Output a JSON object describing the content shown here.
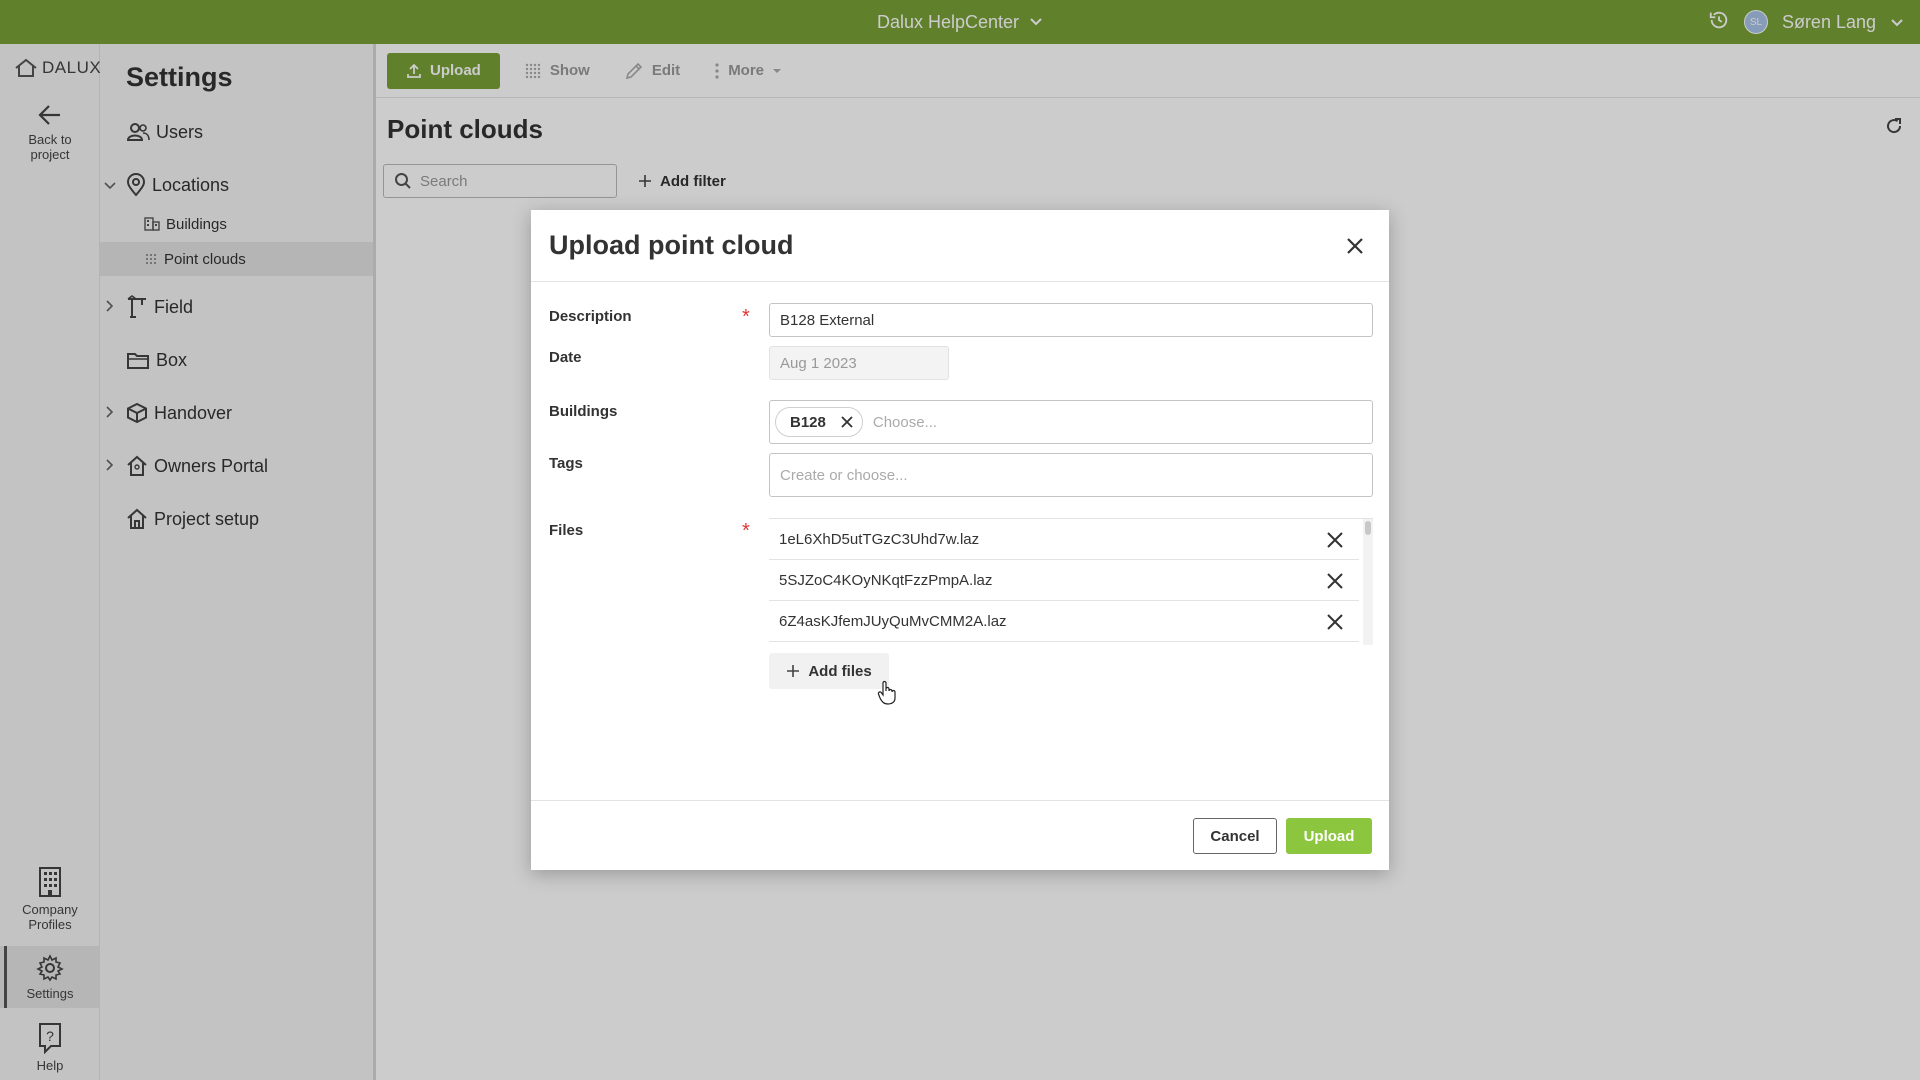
{
  "topbar": {
    "app_name": "Dalux HelpCenter",
    "user_initials": "SL",
    "user_name": "Søren Lang"
  },
  "rail": {
    "logo": "DALUX",
    "back_label_1": "Back to",
    "back_label_2": "project",
    "company_label_1": "Company",
    "company_label_2": "Profiles",
    "settings_label": "Settings",
    "help_label": "Help"
  },
  "nav": {
    "title": "Settings",
    "users": "Users",
    "locations": "Locations",
    "buildings": "Buildings",
    "point_clouds": "Point clouds",
    "field": "Field",
    "box": "Box",
    "handover": "Handover",
    "owners_portal": "Owners Portal",
    "project_setup": "Project setup"
  },
  "toolbar": {
    "upload": "Upload",
    "show": "Show",
    "edit": "Edit",
    "more": "More"
  },
  "main": {
    "title": "Point clouds",
    "search_placeholder": "Search",
    "add_filter": "Add filter"
  },
  "modal": {
    "title": "Upload point cloud",
    "description_label": "Description",
    "description_value": "B128 External",
    "date_label": "Date",
    "date_value": "Aug 1 2023",
    "buildings_label": "Buildings",
    "building_chip": "B128",
    "buildings_placeholder": "Choose...",
    "tags_label": "Tags",
    "tags_placeholder": "Create or choose...",
    "files_label": "Files",
    "required_mark": "*",
    "files": [
      {
        "name": "1eL6XhD5utTGzC3Uhd7w.laz"
      },
      {
        "name": "5SJZoC4KOyNKqtFzzPmpA.laz"
      },
      {
        "name": "6Z4asKJfemJUyQuMvCMM2A.laz"
      }
    ],
    "add_files": "Add files",
    "cancel": "Cancel",
    "upload": "Upload"
  },
  "colors": {
    "brand": "#78a136",
    "upload_button": "#8cc63f",
    "required": "#e03535"
  }
}
